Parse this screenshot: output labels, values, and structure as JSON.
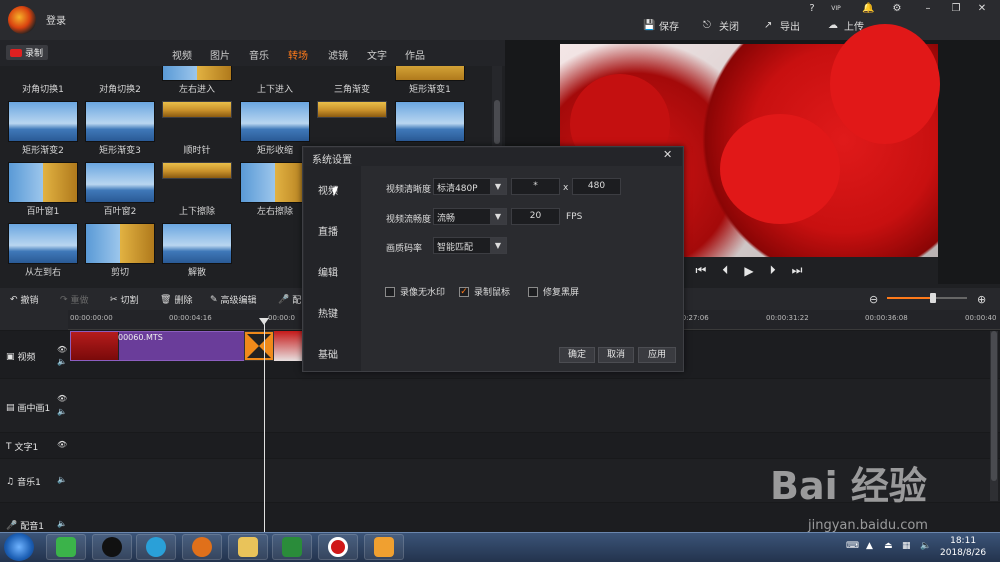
{
  "app": {
    "login": "登录"
  },
  "window_controls": {
    "help": "?",
    "vip": "VIP"
  },
  "actions": {
    "save": "保存",
    "close": "关闭",
    "export": "导出",
    "upload": "上传"
  },
  "record_button": "录制",
  "media_tabs": [
    "视频",
    "图片",
    "音乐",
    "转场",
    "滤镜",
    "文字",
    "作品"
  ],
  "active_tab": "转场",
  "transitions": [
    {
      "label": "对角切换1"
    },
    {
      "label": "对角切换2"
    },
    {
      "label": "左右进入"
    },
    {
      "label": "上下进入"
    },
    {
      "label": "三角渐变"
    },
    {
      "label": "矩形渐变1"
    },
    {
      "label": "矩形渐变2"
    },
    {
      "label": "矩形渐变3"
    },
    {
      "label": "顺时针"
    },
    {
      "label": "矩形收缩"
    },
    {
      "label": ""
    },
    {
      "label": ""
    },
    {
      "label": "百叶窗1"
    },
    {
      "label": "百叶窗2"
    },
    {
      "label": "上下擦除"
    },
    {
      "label": "左右擦除"
    },
    {
      "label": "从左到右"
    },
    {
      "label": "剪切"
    },
    {
      "label": "解散"
    }
  ],
  "editing_toolbar": {
    "undo": "撤销",
    "redo": "重做",
    "cut": "切割",
    "delete": "删除",
    "advanced": "高级编辑",
    "dub": "配"
  },
  "ruler_ticks": [
    "00:00:00:00",
    "00:00:04:16",
    "00:00:0",
    "00:00:27:06",
    "00:00:31:22",
    "00:00:36:08",
    "00:00:40"
  ],
  "tracks": {
    "video": "视频",
    "pip": "画中画1",
    "text": "文字1",
    "music": "音乐1",
    "voice": "配音1"
  },
  "clip": {
    "name": "00060.MTS"
  },
  "dialog": {
    "title": "系统设置",
    "close": "✕",
    "side": [
      "视频",
      "直播",
      "编辑",
      "热键",
      "基础"
    ],
    "resolution_label": "视频清晰度",
    "resolution_value": "标清480P",
    "width_value": "*",
    "times": "x",
    "height_value": "480",
    "fluency_label": "视频流畅度",
    "fluency_value": "流畅",
    "fps_value": "20",
    "fps_unit": "FPS",
    "bitrate_label": "画质码率",
    "bitrate_value": "智能匹配",
    "options": [
      {
        "label": "录像无水印",
        "checked": false
      },
      {
        "label": "录制鼠标",
        "checked": true
      },
      {
        "label": "修复黑屏",
        "checked": false
      }
    ],
    "confirm": "确定",
    "cancel": "取消",
    "apply": "应用"
  },
  "taskbar": {
    "time": "18:11",
    "date": "2018/8/26"
  },
  "watermark": {
    "main": "Bai 经验",
    "sub": "jingyan.baidu.com"
  },
  "colors": {
    "accent": "#ff7a1a",
    "clip": "#6a3d9a",
    "record": "#e02020"
  }
}
